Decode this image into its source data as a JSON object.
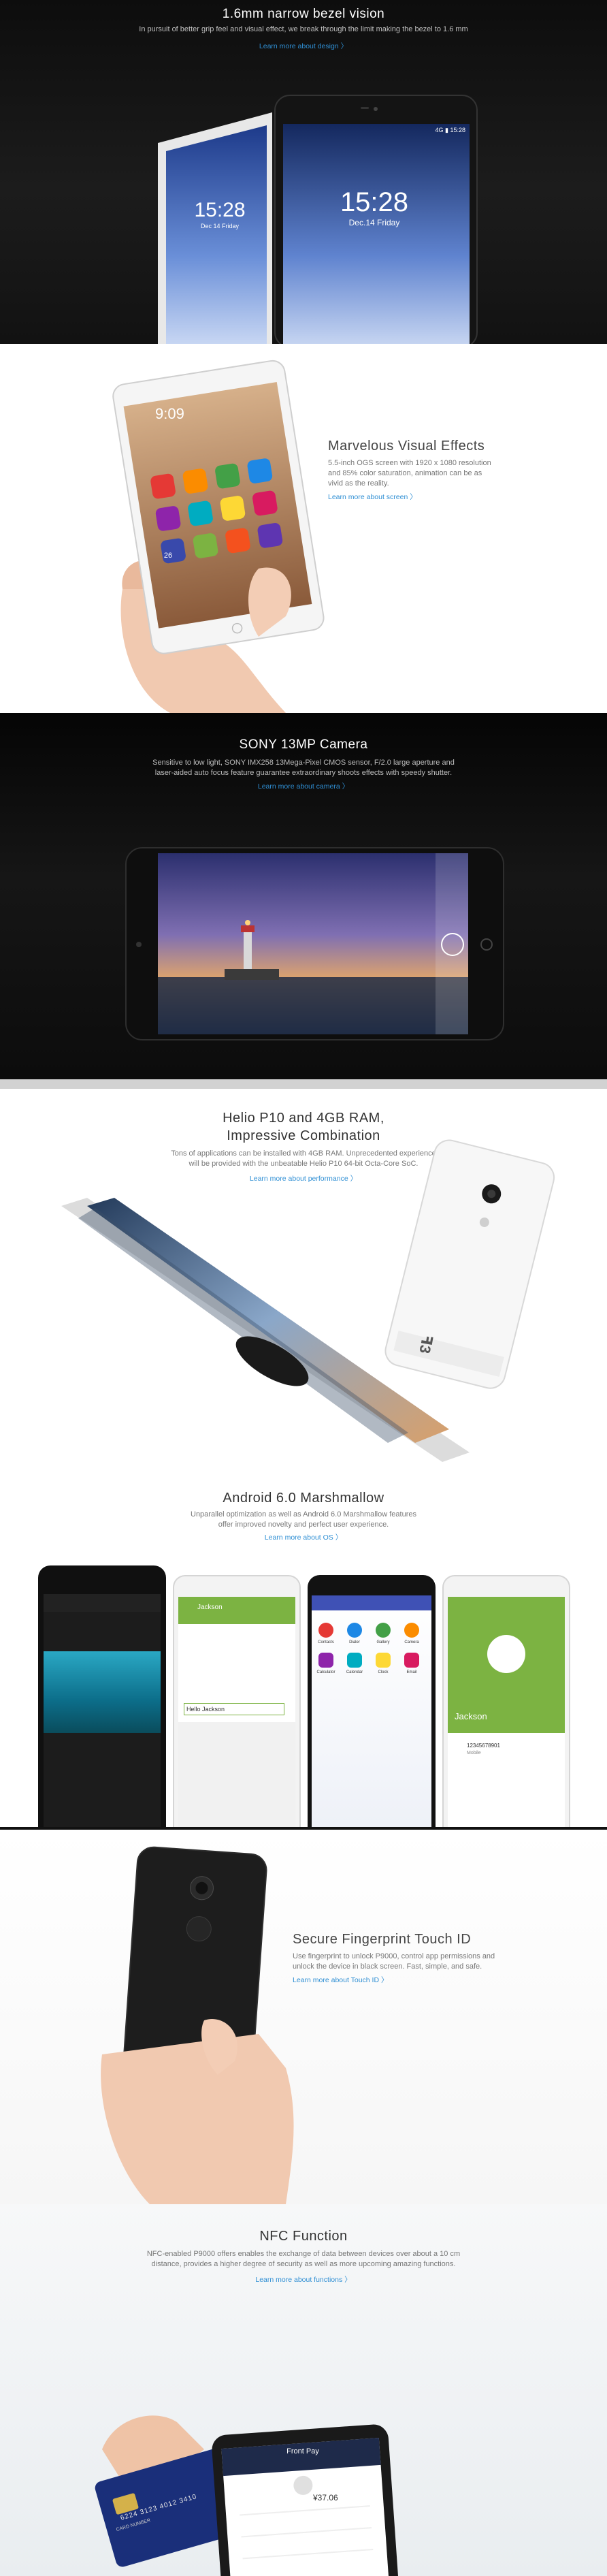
{
  "bezel": {
    "title": "1.6mm narrow bezel vision",
    "desc": "In pursuit of better grip feel and visual effect, we break through the limit making the bezel to 1.6 mm",
    "link": "Learn more about design 〉",
    "phone_left_time": "15:28",
    "phone_left_date": "Dec 14 Friday",
    "phone_right_time": "15:28",
    "phone_right_date": "Dec.14 Friday",
    "phone_right_status": "4G ▮ 15:28"
  },
  "visual": {
    "title": "Marvelous Visual Effects",
    "desc_lines": [
      "5.5-inch OGS screen with 1920 x 1080 resolution",
      "and 85% color saturation, animation can be as",
      "vivid as the reality."
    ],
    "link": "Learn more about screen 〉",
    "phone_time": "9:09",
    "phone_badge": "26"
  },
  "camera": {
    "title": "SONY 13MP Camera",
    "desc_lines": [
      "Sensitive to low light, SONY IMX258 13Mega-Pixel CMOS sensor, F/2.0 large aperture and",
      "laser-aided auto focus feature guarantee extraordinary shoots effects with speedy shutter."
    ],
    "link": "Learn more about camera 〉"
  },
  "helio": {
    "title_lines": [
      "Helio P10 and 4GB RAM,",
      "Impressive Combination"
    ],
    "desc_lines": [
      "Tons of applications can be installed with 4GB RAM. Unprecedented experience",
      "will be provided with the unbeatable Helio P10 64-bit Octa-Core SoC."
    ],
    "link": "Learn more about performance 〉",
    "logo": "ꟻ3"
  },
  "android": {
    "title": "Android 6.0 Marshmallow",
    "desc_lines": [
      "Unparallel optimization as well as Android 6.0 Marshmallow features",
      "offer improved novelty and perfect user experience."
    ],
    "link": "Learn more about OS 〉",
    "chat_name": "Jackson",
    "chat_input": "Hello Jackson",
    "contact_name": "Jackson",
    "contact_number": "12345678901",
    "contact_label": "Mobile",
    "app_labels": [
      "Contacts",
      "Dialer",
      "Gallery",
      "Camera",
      "Calculator",
      "Calendar",
      "Clock",
      "Email"
    ]
  },
  "fingerprint": {
    "title": "Secure Fingerprint Touch ID",
    "desc_lines": [
      "Use fingerprint to unlock P9000, control app permissions and",
      "unlock the device in black screen. Fast, simple, and safe."
    ],
    "link": "Learn more about Touch ID 〉"
  },
  "nfc": {
    "title": "NFC Function",
    "desc_lines": [
      "NFC-enabled P9000 offers enables the exchange of data between devices over about a 10 cm",
      "distance, provides a higher degree of security as well as more upcoming amazing functions."
    ],
    "link": "Learn more about functions 〉",
    "app_title": "Front Pay",
    "amount": "¥37.06",
    "card_number": "6224 3123 4012 3410",
    "card_name": "CARD NUMBER"
  },
  "colors": {
    "accent": "#2f8fd4",
    "dark_bg": "#111111",
    "android_green": "#7cb342"
  }
}
